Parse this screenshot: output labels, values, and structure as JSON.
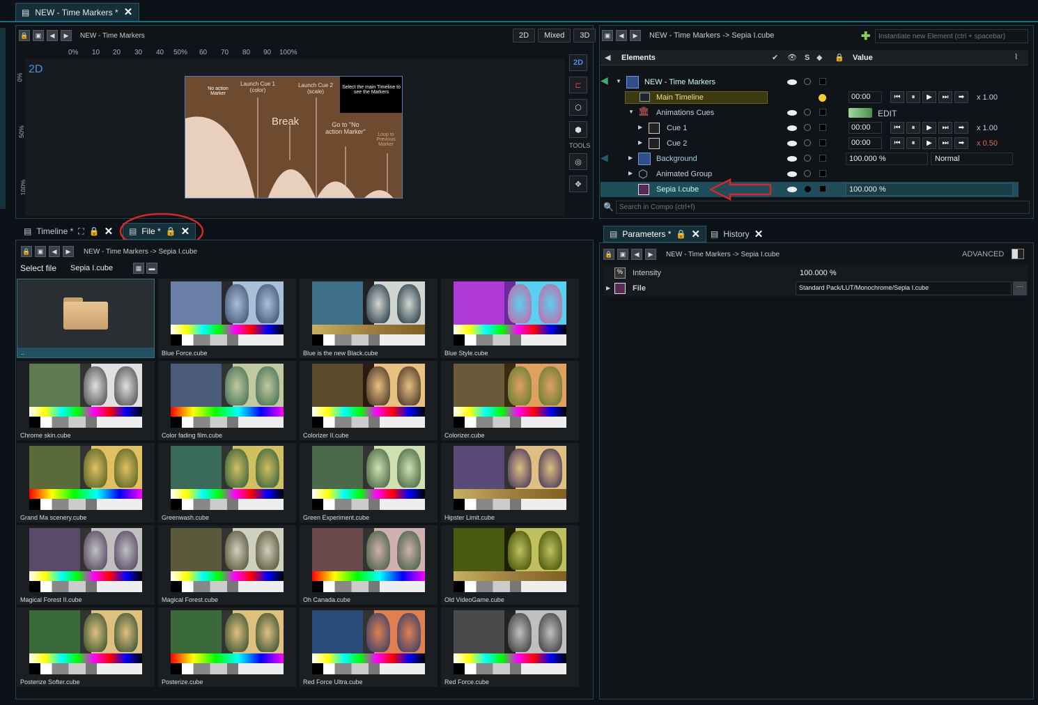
{
  "window": {
    "title": "NEW - Time Markers *"
  },
  "viewer": {
    "breadcrumb": "NEW - Time Markers",
    "modes": [
      "2D",
      "Mixed",
      "3D"
    ],
    "label_2d": "2D",
    "ruler_h": [
      "0%",
      "10",
      "20",
      "30",
      "40",
      "50%",
      "60",
      "70",
      "80",
      "90",
      "100%"
    ],
    "ruler_v": [
      "0%",
      "50%",
      "100%"
    ],
    "tools_label": "TOOLS",
    "side_2d": "2D",
    "scene": {
      "no_action": "No action Marker",
      "cue1": "Launch Cue 1 (color)",
      "cue2": "Launch Cue 2 (scale)",
      "select": "Select the main Timeline to see the Markers",
      "break": "Break",
      "goto": "Go to \"No action Marker\"",
      "loop": "Loop to Previous Marker"
    }
  },
  "lower_tabs": {
    "timeline": "Timeline *",
    "file": "File *"
  },
  "file_panel": {
    "breadcrumb": "NEW - Time Markers -> Sepia I.cube",
    "select_label": "Select file",
    "select_value": "Sepia I.cube",
    "folder_name": "..",
    "files": [
      "Blue Force.cube",
      "Blue is the new Black.cube",
      "Blue Style.cube",
      "Chrome skin.cube",
      "Color fading film.cube",
      "Colorizer II.cube",
      "Colorizer.cube",
      "Grand Ma scenery.cube",
      "Greenwash.cube",
      "Green Experiment.cube",
      "Hipster Limit.cube",
      "Magical Forest II.cube",
      "Magical Forest.cube",
      "Oh Canada.cube",
      "Old VideoGame.cube",
      "Posterize Softer.cube",
      "Posterize.cube",
      "Red Force Ultra.cube",
      "Red Force.cube"
    ]
  },
  "elements_panel": {
    "breadcrumb": "NEW - Time Markers -> Sepia I.cube",
    "instantiate_placeholder": "Instantiate new Element (ctrl + spacebar)",
    "header_elements": "Elements",
    "header_s": "S",
    "header_value": "Value",
    "rows": [
      {
        "name": "NEW - Time Markers"
      },
      {
        "name": "Main Timeline",
        "time": "00:00",
        "speed": "x 1.00"
      },
      {
        "name": "Animations Cues",
        "value": "EDIT"
      },
      {
        "name": "Cue 1",
        "time": "00:00",
        "speed": "x 1.00"
      },
      {
        "name": "Cue 2",
        "time": "00:00",
        "speed": "x 0.50"
      },
      {
        "name": "Background",
        "value": "100.000 %",
        "blend": "Normal"
      },
      {
        "name": "Animated Group"
      },
      {
        "name": "Sepia I.cube",
        "value": "100.000 %"
      }
    ],
    "search_placeholder": "Search in Compo (ctrl+f)"
  },
  "params_panel": {
    "tab": "Parameters *",
    "history_tab": "History",
    "breadcrumb": "NEW - Time Markers -> Sepia I.cube",
    "advanced": "ADVANCED",
    "intensity_label": "Intensity",
    "intensity_value": "100.000 %",
    "file_label": "File",
    "file_value": "Standard Pack/LUT/Monochrome/Sepia I.cube"
  },
  "colors": {
    "accent": "#2d6f82",
    "highlight_row": "#1f4d5b",
    "annotation": "#d8262a"
  }
}
